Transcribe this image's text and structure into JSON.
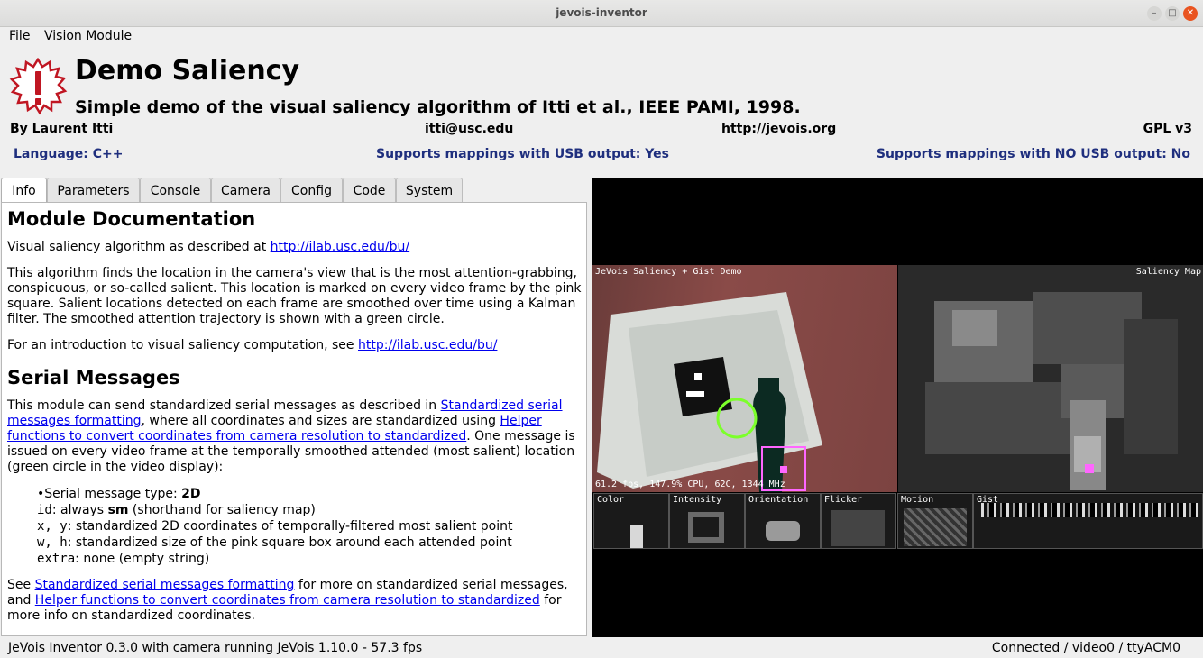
{
  "window": {
    "title": "jevois-inventor"
  },
  "menu": {
    "file": "File",
    "vision_module": "Vision Module"
  },
  "module": {
    "title": "Demo Saliency",
    "subtitle": "Simple demo of the visual saliency algorithm of Itti et al., IEEE PAMI, 1998.",
    "author": "By Laurent Itti",
    "email": "itti@usc.edu",
    "website": "http://jevois.org",
    "license": "GPL v3",
    "language": "Language: C++",
    "usb_mappings": "Supports mappings with USB output: Yes",
    "nousb_mappings": "Supports mappings with NO USB output: No"
  },
  "tabs": [
    "Info",
    "Parameters",
    "Console",
    "Camera",
    "Config",
    "Code",
    "System"
  ],
  "doc": {
    "h1": "Module Documentation",
    "p1_text": "Visual saliency algorithm as described at ",
    "p1_link": "http://ilab.usc.edu/bu/",
    "p2": "This algorithm finds the location in the camera's view that is the most attention-grabbing, conspicuous, or so-called salient. This location is marked on every video frame by the pink square. Salient locations detected on each frame are smoothed over time using a Kalman filter. The smoothed attention trajectory is shown with a green circle.",
    "p3_text": "For an introduction to visual saliency computation, see ",
    "p3_link": "http://ilab.usc.edu/bu/",
    "h2": "Serial Messages",
    "p4_a": "This module can send standardized serial messages as described in ",
    "p4_link1": "Standardized serial messages formatting",
    "p4_b": ", where all coordinates and sizes are standardized using ",
    "p4_link2": "Helper functions to convert coordinates from camera resolution to standardized",
    "p4_c": ". One message is issued on every video frame at the temporally smoothed attended (most salient) location (green circle in the video display):",
    "bullets": [
      {
        "code": "",
        "pre": "Serial message type: ",
        "bold": "2D",
        "post": ""
      },
      {
        "code": "id",
        "pre": ": always ",
        "bold": "sm",
        "post": " (shorthand for saliency map)"
      },
      {
        "code": "x, y",
        "pre": ": standardized 2D coordinates of temporally-filtered most salient point",
        "bold": "",
        "post": ""
      },
      {
        "code": "w, h",
        "pre": ": standardized size of the pink square box around each attended point",
        "bold": "",
        "post": ""
      },
      {
        "code": "extra",
        "pre": ": none (empty string)",
        "bold": "",
        "post": ""
      }
    ],
    "p5_a": "See ",
    "p5_link1": "Standardized serial messages formatting",
    "p5_b": " for more on standardized serial messages, and ",
    "p5_link2": "Helper functions to convert coordinates from camera resolution to standardized",
    "p5_c": " for more info on standardized coordinates."
  },
  "video": {
    "cam_label": "JeVois Saliency + Gist Demo",
    "map_label": "Saliency Map",
    "fps_overlay": "61.2 fps, 147.9% CPU, 62C, 1344 MHz",
    "strips": [
      "Color",
      "Intensity",
      "Orientation",
      "Flicker",
      "Motion",
      "Gist"
    ]
  },
  "status": {
    "left": "JeVois Inventor 0.3.0 with camera running JeVois 1.10.0 - 57.3 fps",
    "right": "Connected / video0 / ttyACM0"
  },
  "colors": {
    "accent_link": "#0000ee",
    "lang_row": "#1f2f7e",
    "close_btn": "#e95420",
    "attention_circle": "#7cff2b",
    "salient_box": "#ff66ff"
  }
}
